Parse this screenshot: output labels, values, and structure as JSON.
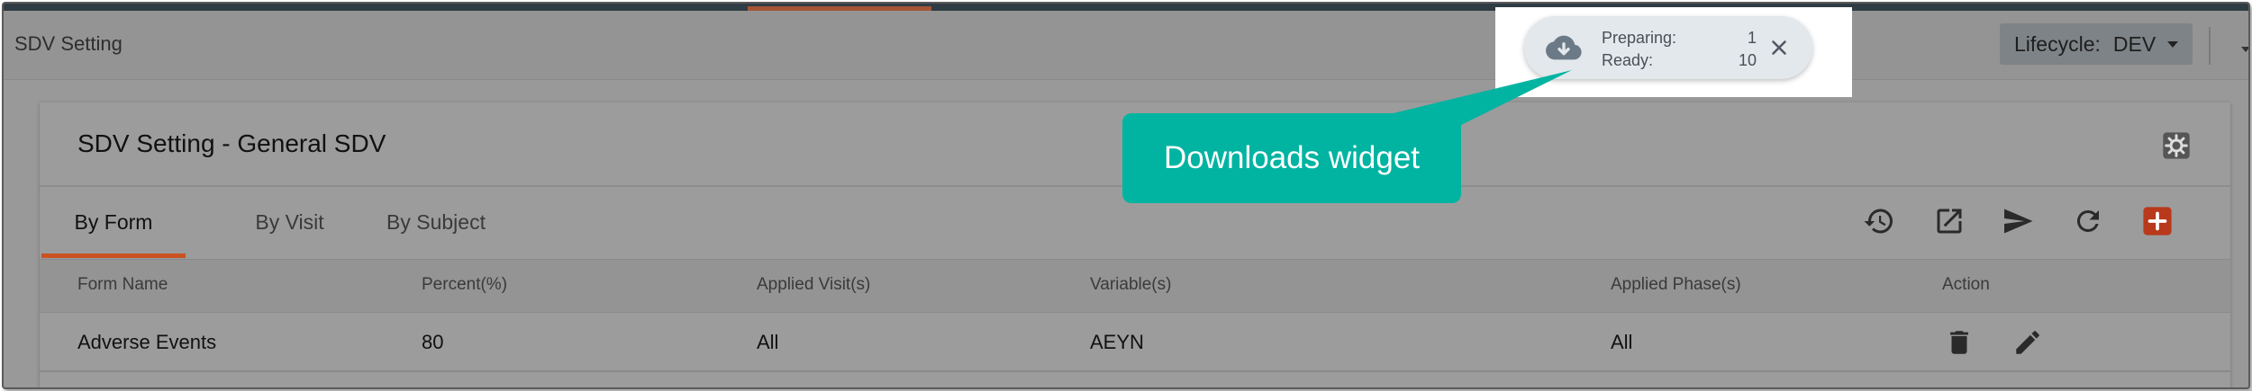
{
  "app": {
    "title": "SDV Setting",
    "lifecycle_label": "Lifecycle:",
    "lifecycle_value": "DEV"
  },
  "downloads": {
    "preparing_label": "Preparing:",
    "preparing_count": "1",
    "ready_label": "Ready:",
    "ready_count": "10",
    "icon": "cloud-download-icon"
  },
  "callout": {
    "text": "Downloads widget",
    "color": "#00b4a1"
  },
  "card": {
    "title": "SDV Setting - General SDV",
    "tabs": [
      {
        "label": "By Form",
        "active": true
      },
      {
        "label": "By Visit",
        "active": false
      },
      {
        "label": "By Subject",
        "active": false
      }
    ],
    "toolbar_icons": [
      "history-icon",
      "open-external-icon",
      "send-icon",
      "refresh-icon",
      "add-icon"
    ],
    "accent": "#c9521f"
  },
  "table": {
    "columns": [
      "Form Name",
      "Percent(%)",
      "Applied Visit(s)",
      "Variable(s)",
      "Applied Phase(s)",
      "Action"
    ],
    "rows": [
      {
        "form_name": "Adverse Events",
        "percent": "80",
        "visits": "All",
        "variables": "AEYN",
        "phases": "All"
      }
    ]
  }
}
